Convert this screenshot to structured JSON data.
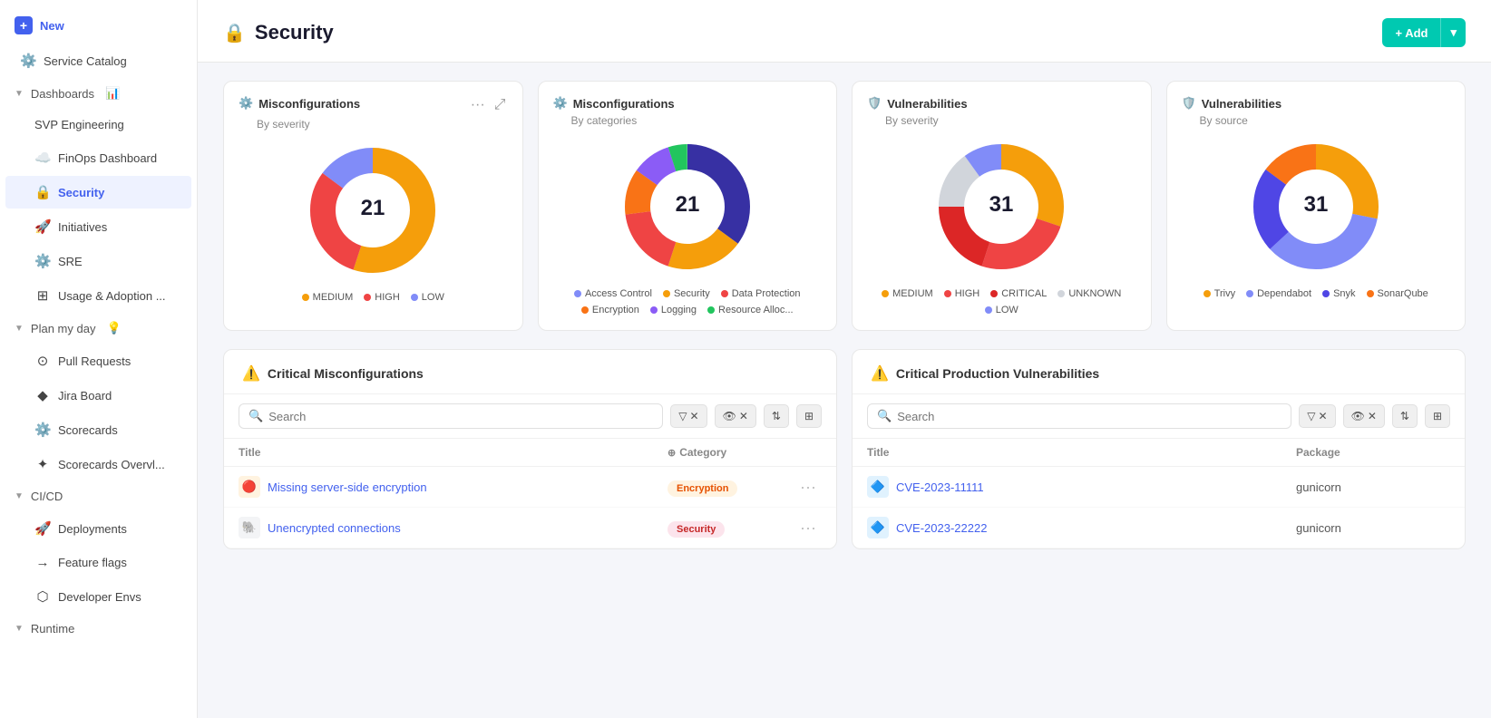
{
  "sidebar": {
    "new_label": "New",
    "service_catalog": "Service Catalog",
    "dashboards": "Dashboards",
    "svp_engineering": "SVP Engineering",
    "finops_dashboard": "FinOps Dashboard",
    "security": "Security",
    "initiatives": "Initiatives",
    "sre": "SRE",
    "usage_adoption": "Usage & Adoption ...",
    "plan_my_day": "Plan my day",
    "pull_requests": "Pull Requests",
    "jira_board": "Jira Board",
    "scorecards": "Scorecards",
    "scorecards_overview": "Scorecards Overvl...",
    "cicd": "CI/CD",
    "deployments": "Deployments",
    "feature_flags": "Feature flags",
    "developer_envs": "Developer Envs",
    "runtime": "Runtime"
  },
  "page": {
    "title": "Security",
    "add_button": "+ Add"
  },
  "charts": [
    {
      "id": "misc_severity",
      "title": "Misconfigurations",
      "subtitle": "By severity",
      "center_value": "21",
      "legend": [
        {
          "label": "MEDIUM",
          "color": "#f59e0b"
        },
        {
          "label": "HIGH",
          "color": "#ef4444"
        },
        {
          "label": "LOW",
          "color": "#818cf8"
        }
      ],
      "segments": [
        {
          "pct": 55,
          "color": "#f59e0b"
        },
        {
          "pct": 30,
          "color": "#ef4444"
        },
        {
          "pct": 15,
          "color": "#818cf8"
        }
      ]
    },
    {
      "id": "misc_categories",
      "title": "Misconfigurations",
      "subtitle": "By categories",
      "center_value": "21",
      "legend": [
        {
          "label": "Access Control",
          "color": "#818cf8"
        },
        {
          "label": "Security",
          "color": "#f59e0b"
        },
        {
          "label": "Data Protection",
          "color": "#ef4444"
        },
        {
          "label": "Encryption",
          "color": "#f97316"
        },
        {
          "label": "Logging",
          "color": "#8b5cf6"
        },
        {
          "label": "Resource Alloc...",
          "color": "#22c55e"
        }
      ],
      "segments": [
        {
          "pct": 35,
          "color": "#3730a3"
        },
        {
          "pct": 20,
          "color": "#f59e0b"
        },
        {
          "pct": 18,
          "color": "#ef4444"
        },
        {
          "pct": 12,
          "color": "#f97316"
        },
        {
          "pct": 10,
          "color": "#8b5cf6"
        },
        {
          "pct": 5,
          "color": "#22c55e"
        }
      ]
    },
    {
      "id": "vuln_severity",
      "title": "Vulnerabilities",
      "subtitle": "By severity",
      "center_value": "31",
      "legend": [
        {
          "label": "MEDIUM",
          "color": "#f59e0b"
        },
        {
          "label": "HIGH",
          "color": "#ef4444"
        },
        {
          "label": "CRITICAL",
          "color": "#dc2626"
        },
        {
          "label": "UNKNOWN",
          "color": "#d1d5db"
        },
        {
          "label": "LOW",
          "color": "#818cf8"
        }
      ],
      "segments": [
        {
          "pct": 30,
          "color": "#f59e0b"
        },
        {
          "pct": 25,
          "color": "#ef4444"
        },
        {
          "pct": 20,
          "color": "#dc2626"
        },
        {
          "pct": 15,
          "color": "#d1d5db"
        },
        {
          "pct": 10,
          "color": "#818cf8"
        }
      ]
    },
    {
      "id": "vuln_source",
      "title": "Vulnerabilities",
      "subtitle": "By source",
      "center_value": "31",
      "legend": [
        {
          "label": "Trivy",
          "color": "#f59e0b"
        },
        {
          "label": "Dependabot",
          "color": "#818cf8"
        },
        {
          "label": "Snyk",
          "color": "#6366f1"
        },
        {
          "label": "SonarQube",
          "color": "#f97316"
        }
      ],
      "segments": [
        {
          "pct": 28,
          "color": "#f59e0b"
        },
        {
          "pct": 35,
          "color": "#818cf8"
        },
        {
          "pct": 22,
          "color": "#6366f1"
        },
        {
          "pct": 15,
          "color": "#f97316"
        }
      ]
    }
  ],
  "critical_misconfigs": {
    "title": "Critical Misconfigurations",
    "search_placeholder": "Search",
    "col_title": "Title",
    "col_category": "Category",
    "rows": [
      {
        "icon": "🔴",
        "title": "Missing server-side encryption",
        "title_color": "#4361ee",
        "category": "Encryption",
        "badge_class": "badge-encryption",
        "icon_bg": "#fff3e0"
      },
      {
        "icon": "🐘",
        "title": "Unencrypted connections",
        "title_color": "#4361ee",
        "category": "Security",
        "badge_class": "badge-security",
        "icon_bg": "#fce4ec"
      }
    ]
  },
  "critical_vulnerabilities": {
    "title": "Critical Production Vulnerabilities",
    "search_placeholder": "Search",
    "col_title": "Title",
    "col_package": "Package",
    "rows": [
      {
        "icon": "🔷",
        "title": "CVE-2023-11111",
        "title_color": "#4361ee",
        "package": "gunicorn",
        "icon_bg": "#e0f2fe"
      },
      {
        "icon": "🔷",
        "title": "CVE-2023-22222",
        "title_color": "#4361ee",
        "package": "gunicorn",
        "icon_bg": "#e0f2fe"
      }
    ]
  }
}
